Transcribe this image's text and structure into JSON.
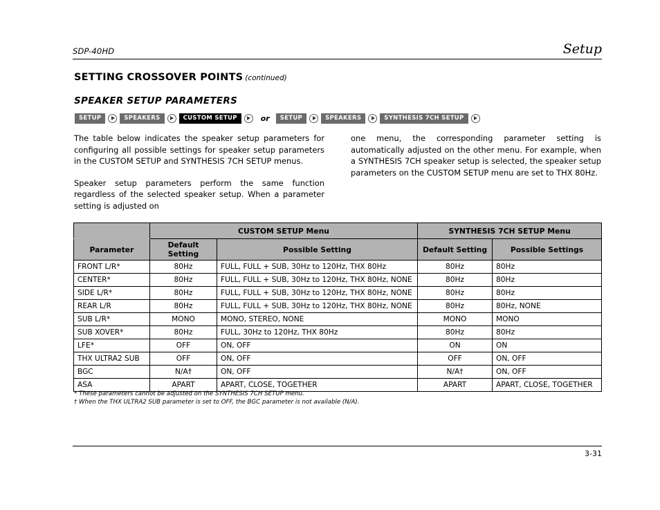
{
  "running_head": {
    "model": "SDP-40HD",
    "section": "Setup"
  },
  "section_title": {
    "main": "SETTING CROSSOVER POINTS",
    "continued": "(continued)"
  },
  "subsection_title": "SPEAKER SETUP PARAMETERS",
  "breadcrumbs": {
    "or_label": "or",
    "chain_a": [
      "SETUP",
      "SPEAKERS",
      "CUSTOM SETUP"
    ],
    "chain_a_active_index": 2,
    "chain_b": [
      "SETUP",
      "SPEAKERS",
      "SYNTHESIS 7CH SETUP"
    ],
    "chain_b_active_index": -1,
    "chip_color": "#6b6b6b",
    "chip_active_color": "#000000"
  },
  "body": {
    "left": [
      "The table below indicates the speaker setup parameters for configuring all possible settings for speaker setup parameters in the CUSTOM SETUP and SYNTHESIS 7CH SETUP menus.",
      "Speaker setup parameters perform the same function regardless of the selected speaker setup. When a parameter setting is adjusted on"
    ],
    "right": [
      "one menu, the corresponding parameter setting is automatically adjusted on the other menu. For example, when a SYNTHESIS 7CH speaker setup is selected, the speaker setup parameters on the CUSTOM SETUP menu are set to THX 80Hz."
    ]
  },
  "table": {
    "group_headers": {
      "custom": "CUSTOM SETUP Menu",
      "synthesis": "SYNTHESIS 7CH SETUP Menu"
    },
    "column_headers": {
      "parameter": "Parameter",
      "custom_default": "Default Setting",
      "custom_possible": "Possible Setting",
      "synthesis_default": "Default Setting",
      "synthesis_possible": "Possible Settings"
    },
    "header_bg": "#b3b3b3",
    "rows": [
      {
        "parameter": "FRONT L/R*",
        "custom_default": "80Hz",
        "custom_possible": "FULL, FULL + SUB, 30Hz to 120Hz, THX 80Hz",
        "synthesis_default": "80Hz",
        "synthesis_possible": "80Hz"
      },
      {
        "parameter": "CENTER*",
        "custom_default": "80Hz",
        "custom_possible": "FULL, FULL + SUB, 30Hz to 120Hz, THX 80Hz, NONE",
        "synthesis_default": "80Hz",
        "synthesis_possible": "80Hz"
      },
      {
        "parameter": "SIDE L/R*",
        "custom_default": "80Hz",
        "custom_possible": "FULL, FULL + SUB, 30Hz to 120Hz, THX 80Hz, NONE",
        "synthesis_default": "80Hz",
        "synthesis_possible": "80Hz"
      },
      {
        "parameter": "REAR L/R",
        "custom_default": "80Hz",
        "custom_possible": "FULL, FULL + SUB, 30Hz to 120Hz, THX 80Hz, NONE",
        "synthesis_default": "80Hz",
        "synthesis_possible": "80Hz, NONE"
      },
      {
        "parameter": "SUB L/R*",
        "custom_default": "MONO",
        "custom_possible": "MONO, STEREO, NONE",
        "synthesis_default": "MONO",
        "synthesis_possible": "MONO"
      },
      {
        "parameter": "SUB XOVER*",
        "custom_default": "80Hz",
        "custom_possible": "FULL, 30Hz to 120Hz, THX 80Hz",
        "synthesis_default": "80Hz",
        "synthesis_possible": "80Hz"
      },
      {
        "parameter": "LFE*",
        "custom_default": "OFF",
        "custom_possible": "ON, OFF",
        "synthesis_default": "ON",
        "synthesis_possible": "ON"
      },
      {
        "parameter": "THX ULTRA2 SUB",
        "custom_default": "OFF",
        "custom_possible": "ON, OFF",
        "synthesis_default": "OFF",
        "synthesis_possible": "ON, OFF"
      },
      {
        "parameter": "BGC",
        "custom_default": "N/A†",
        "custom_possible": "ON, OFF",
        "synthesis_default": "N/A†",
        "synthesis_possible": "ON, OFF"
      },
      {
        "parameter": "ASA",
        "custom_default": "APART",
        "custom_possible": "APART, CLOSE, TOGETHER",
        "synthesis_default": "APART",
        "synthesis_possible": "APART, CLOSE, TOGETHER"
      }
    ]
  },
  "footnotes": [
    "* These parameters cannot be adjusted on the SYNTHESIS 7CH SETUP menu.",
    "† When the THX ULTRA2 SUB parameter is set to OFF, the BGC parameter is not available (N/A)."
  ],
  "page_number": "3-31"
}
